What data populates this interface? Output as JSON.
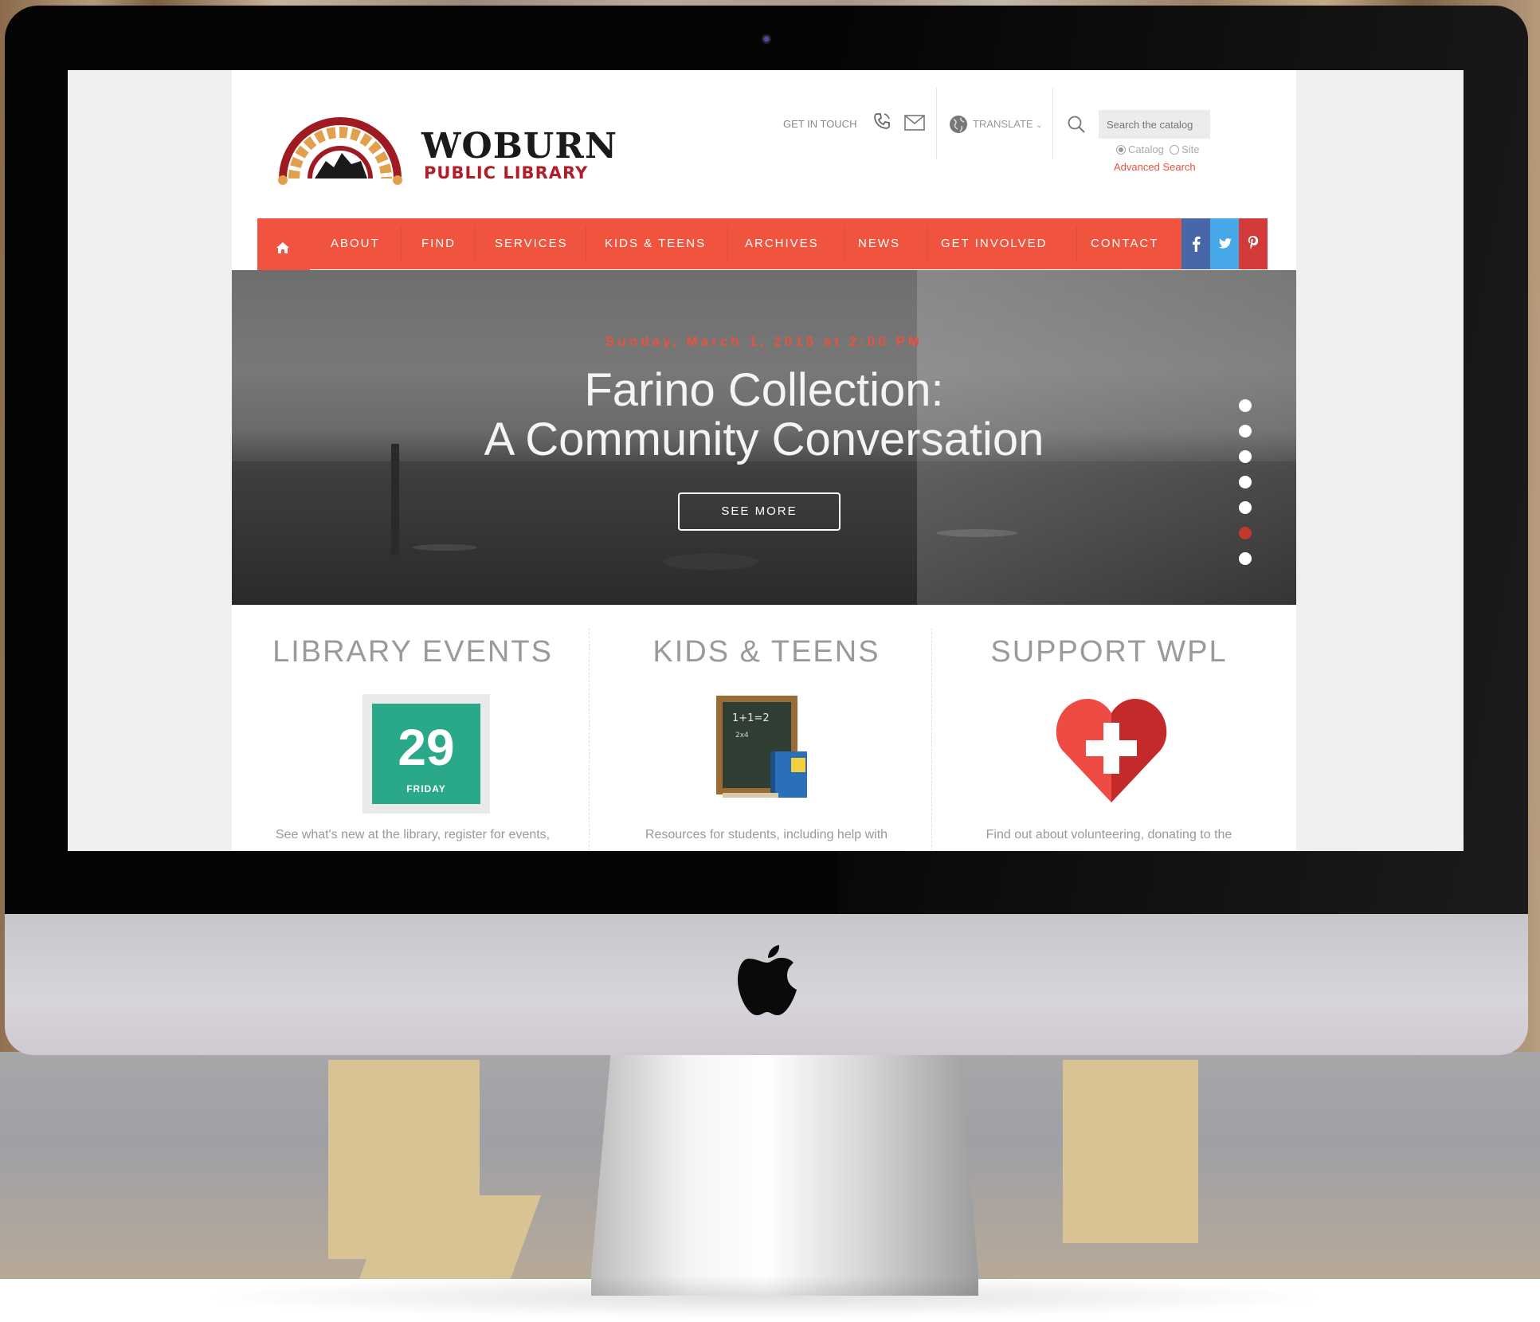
{
  "site": {
    "logo_title": "WOBURN",
    "logo_subtitle": "PUBLIC LIBRARY"
  },
  "header": {
    "get_in_touch": "GET IN TOUCH",
    "translate": "TRANSLATE",
    "search_placeholder": "Search the catalog",
    "search_options": [
      "Catalog",
      "Site"
    ],
    "search_selected": "Catalog",
    "advanced_search": "Advanced Search"
  },
  "nav": {
    "items": [
      "ABOUT",
      "FIND",
      "SERVICES",
      "KIDS & TEENS",
      "ARCHIVES",
      "NEWS",
      "GET INVOLVED",
      "CONTACT"
    ],
    "social": [
      "facebook-icon",
      "twitter-icon",
      "pinterest-icon"
    ],
    "social_colors": [
      "#4767a8",
      "#46a8e8",
      "#d33a3a"
    ],
    "accent": "#f0543e"
  },
  "hero": {
    "date": "Sunday, March 1, 2015 at 2:00 PM",
    "title_line1": "Farino Collection:",
    "title_line2": "A Community Conversation",
    "cta": "SEE MORE",
    "slide_count": 7,
    "active_slide": 6
  },
  "features": [
    {
      "title": "LIBRARY EVENTS",
      "text": "See what's new at the library, register for events,",
      "calendar_number": "29",
      "calendar_day": "FRIDAY"
    },
    {
      "title": "KIDS & TEENS",
      "text": "Resources for students, including help with"
    },
    {
      "title": "SUPPORT WPL",
      "text": "Find out about volunteering, donating to the"
    }
  ]
}
